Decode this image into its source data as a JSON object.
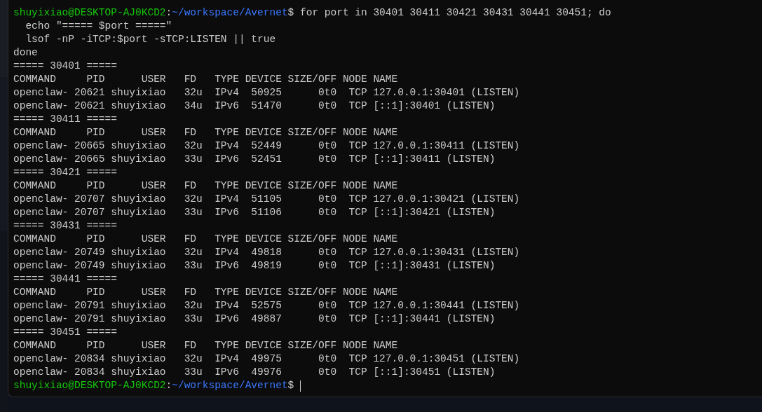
{
  "terminal": {
    "lines": [
      {
        "kind": "prompt",
        "user_host": "shuyixiao@DESKTOP-AJ0KCD2",
        "separator": ":",
        "path": "~/workspace/Avernet",
        "symbol": "$",
        "command": "for port in 30401 30411 30421 30431 30441 30451; do"
      },
      {
        "kind": "output",
        "text": "  echo \"===== $port =====\""
      },
      {
        "kind": "output",
        "text": "  lsof -nP -iTCP:$port -sTCP:LISTEN || true"
      },
      {
        "kind": "output",
        "text": "done"
      },
      {
        "kind": "output",
        "text": "===== 30401 ====="
      },
      {
        "kind": "output",
        "text": "COMMAND     PID      USER   FD   TYPE DEVICE SIZE/OFF NODE NAME"
      },
      {
        "kind": "output",
        "text": "openclaw- 20621 shuyixiao   32u  IPv4  50925      0t0  TCP 127.0.0.1:30401 (LISTEN)"
      },
      {
        "kind": "output",
        "text": "openclaw- 20621 shuyixiao   34u  IPv6  51470      0t0  TCP [::1]:30401 (LISTEN)"
      },
      {
        "kind": "output",
        "text": "===== 30411 ====="
      },
      {
        "kind": "output",
        "text": "COMMAND     PID      USER   FD   TYPE DEVICE SIZE/OFF NODE NAME"
      },
      {
        "kind": "output",
        "text": "openclaw- 20665 shuyixiao   32u  IPv4  52449      0t0  TCP 127.0.0.1:30411 (LISTEN)"
      },
      {
        "kind": "output",
        "text": "openclaw- 20665 shuyixiao   33u  IPv6  52451      0t0  TCP [::1]:30411 (LISTEN)"
      },
      {
        "kind": "output",
        "text": "===== 30421 ====="
      },
      {
        "kind": "output",
        "text": "COMMAND     PID      USER   FD   TYPE DEVICE SIZE/OFF NODE NAME"
      },
      {
        "kind": "output",
        "text": "openclaw- 20707 shuyixiao   32u  IPv4  51105      0t0  TCP 127.0.0.1:30421 (LISTEN)"
      },
      {
        "kind": "output",
        "text": "openclaw- 20707 shuyixiao   33u  IPv6  51106      0t0  TCP [::1]:30421 (LISTEN)"
      },
      {
        "kind": "output",
        "text": "===== 30431 ====="
      },
      {
        "kind": "output",
        "text": "COMMAND     PID      USER   FD   TYPE DEVICE SIZE/OFF NODE NAME"
      },
      {
        "kind": "output",
        "text": "openclaw- 20749 shuyixiao   32u  IPv4  49818      0t0  TCP 127.0.0.1:30431 (LISTEN)"
      },
      {
        "kind": "output",
        "text": "openclaw- 20749 shuyixiao   33u  IPv6  49819      0t0  TCP [::1]:30431 (LISTEN)"
      },
      {
        "kind": "output",
        "text": "===== 30441 ====="
      },
      {
        "kind": "output",
        "text": "COMMAND     PID      USER   FD   TYPE DEVICE SIZE/OFF NODE NAME"
      },
      {
        "kind": "output",
        "text": "openclaw- 20791 shuyixiao   32u  IPv4  52575      0t0  TCP 127.0.0.1:30441 (LISTEN)"
      },
      {
        "kind": "output",
        "text": "openclaw- 20791 shuyixiao   33u  IPv6  49887      0t0  TCP [::1]:30441 (LISTEN)"
      },
      {
        "kind": "output",
        "text": "===== 30451 ====="
      },
      {
        "kind": "output",
        "text": "COMMAND     PID      USER   FD   TYPE DEVICE SIZE/OFF NODE NAME"
      },
      {
        "kind": "output",
        "text": "openclaw- 20834 shuyixiao   32u  IPv4  49975      0t0  TCP 127.0.0.1:30451 (LISTEN)"
      },
      {
        "kind": "output",
        "text": "openclaw- 20834 shuyixiao   33u  IPv6  49976      0t0  TCP [::1]:30451 (LISTEN)"
      },
      {
        "kind": "active_prompt",
        "user_host": "shuyixiao@DESKTOP-AJ0KCD2",
        "separator": ":",
        "path": "~/workspace/Avernet",
        "symbol": "$"
      }
    ]
  }
}
